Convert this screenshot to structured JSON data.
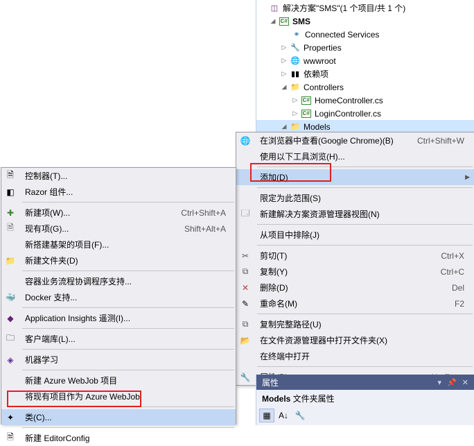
{
  "solution": {
    "title": "解决方案\"SMS\"(1 个项目/共 1 个)",
    "project": "SMS",
    "nodes": {
      "connected": "Connected Services",
      "properties": "Properties",
      "wwwroot": "wwwroot",
      "deps": "依赖项",
      "controllers": "Controllers",
      "home": "HomeController.cs",
      "login": "LoginController.cs",
      "models": "Models"
    }
  },
  "menu_right": {
    "browse": {
      "label": "在浏览器中查看(Google Chrome)(B)",
      "shortcut": "Ctrl+Shift+W"
    },
    "browse_with": {
      "label": "使用以下工具浏览(H)..."
    },
    "add": {
      "label": "添加(D)"
    },
    "scope": {
      "label": "限定为此范围(S)"
    },
    "new_view": {
      "label": "新建解决方案资源管理器视图(N)"
    },
    "exclude": {
      "label": "从项目中排除(J)"
    },
    "cut": {
      "label": "剪切(T)",
      "shortcut": "Ctrl+X"
    },
    "copy": {
      "label": "复制(Y)",
      "shortcut": "Ctrl+C"
    },
    "delete": {
      "label": "删除(D)",
      "shortcut": "Del"
    },
    "rename": {
      "label": "重命名(M)",
      "shortcut": "F2"
    },
    "copy_path": {
      "label": "复制完整路径(U)"
    },
    "open_explorer": {
      "label": "在文件资源管理器中打开文件夹(X)"
    },
    "open_terminal": {
      "label": "在终端中打开"
    },
    "properties": {
      "label": "属性(R)",
      "shortcut": "Alt+Enter"
    }
  },
  "menu_left": {
    "controller": {
      "label": "控制器(T)..."
    },
    "razor": {
      "label": "Razor 组件..."
    },
    "new_item": {
      "label": "新建项(W)...",
      "shortcut": "Ctrl+Shift+A"
    },
    "existing": {
      "label": "现有项(G)...",
      "shortcut": "Shift+Alt+A"
    },
    "scaffold": {
      "label": "新搭建基架的项目(F)..."
    },
    "new_folder": {
      "label": "新建文件夹(D)"
    },
    "container": {
      "label": "容器业务流程协调程序支持..."
    },
    "docker": {
      "label": "Docker 支持..."
    },
    "insights": {
      "label": "Application Insights 遥测(I)..."
    },
    "client_lib": {
      "label": "客户端库(L)..."
    },
    "ml": {
      "label": "机器学习"
    },
    "webjob_new": {
      "label": "新建 Azure WebJob 项目"
    },
    "webjob_existing": {
      "label": "将现有项目作为 Azure WebJob"
    },
    "class": {
      "label": "类(C)..."
    },
    "editorconfig": {
      "label": "新建 EditorConfig"
    }
  },
  "props": {
    "title": "属性",
    "name_bold": "Models",
    "name_rest": " 文件夹属性"
  }
}
